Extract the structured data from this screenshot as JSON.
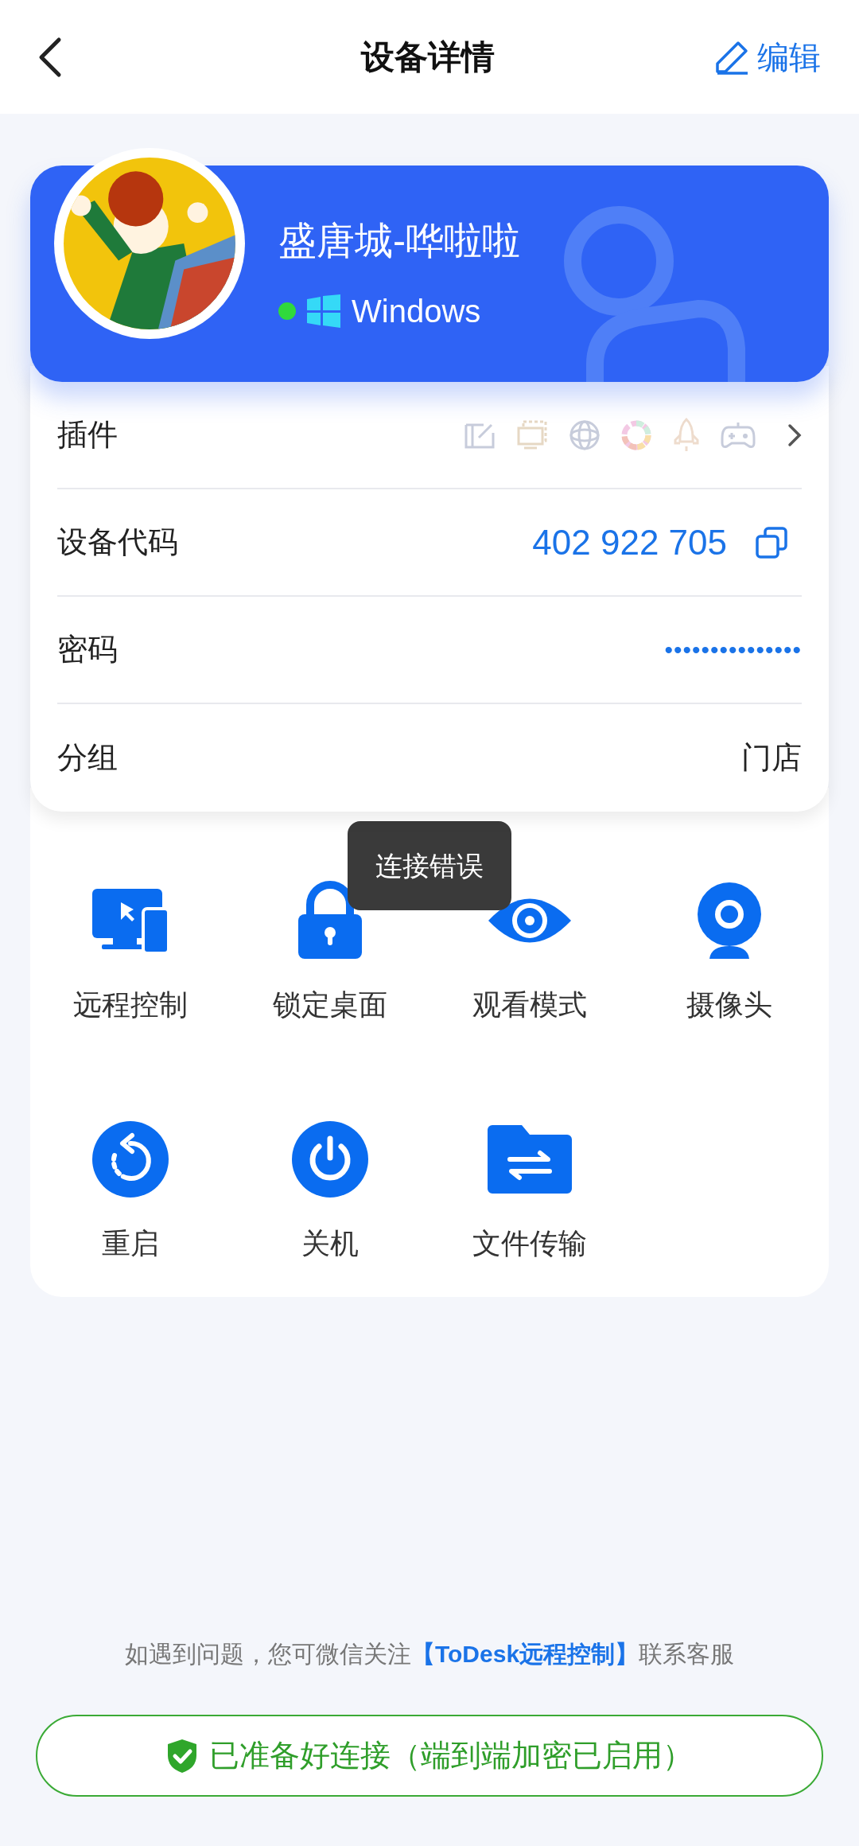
{
  "header": {
    "title": "设备详情",
    "edit_label": "编辑"
  },
  "device": {
    "name": "盛唐城-哗啦啦",
    "online": true,
    "os": "Windows"
  },
  "rows": [
    {
      "kind": "plugins",
      "label": "插件"
    },
    {
      "kind": "code",
      "label": "设备代码",
      "value": "402 922 705"
    },
    {
      "kind": "password",
      "label": "密码",
      "value": "•••••••••••••••"
    },
    {
      "kind": "text",
      "label": "分组",
      "value": "门店"
    }
  ],
  "actions": [
    {
      "kind": "remote",
      "label": "远程控制"
    },
    {
      "kind": "lock",
      "label": "锁定桌面"
    },
    {
      "kind": "watch",
      "label": "观看模式"
    },
    {
      "kind": "camera",
      "label": "摄像头"
    },
    {
      "kind": "restart",
      "label": "重启"
    },
    {
      "kind": "power",
      "label": "关机"
    },
    {
      "kind": "files",
      "label": "文件传输"
    }
  ],
  "toast": "连接错误",
  "footer": {
    "text_before": "如遇到问题，您可微信关注",
    "link": "【ToDesk远程控制】",
    "text_after": "联系客服"
  },
  "status": "已准备好连接（端到端加密已启用）"
}
